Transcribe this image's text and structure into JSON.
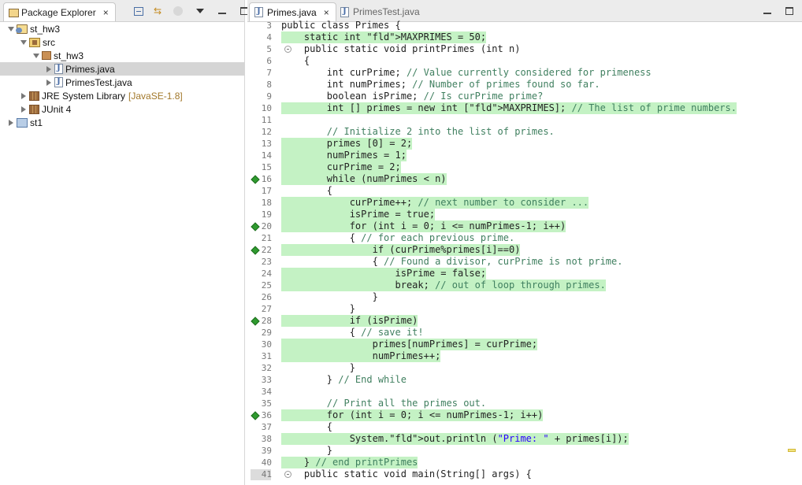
{
  "explorer": {
    "tab_label": "Package Explorer",
    "tab_close": "×",
    "tree": [
      {
        "label": "st_hw3",
        "depth": 0,
        "expanded": true,
        "icon": "java-project-icon"
      },
      {
        "label": "src",
        "depth": 1,
        "expanded": true,
        "icon": "source-folder-icon"
      },
      {
        "label": "st_hw3",
        "depth": 2,
        "expanded": true,
        "icon": "package-icon"
      },
      {
        "label": "Primes.java",
        "depth": 3,
        "expanded": false,
        "icon": "java-file-icon",
        "selected": true
      },
      {
        "label": "PrimesTest.java",
        "depth": 3,
        "expanded": false,
        "icon": "java-file-icon"
      },
      {
        "label": "JRE System Library",
        "tag": "[JavaSE-1.8]",
        "depth": 1,
        "expanded": false,
        "icon": "library-icon"
      },
      {
        "label": "JUnit 4",
        "depth": 1,
        "expanded": false,
        "icon": "library-icon"
      },
      {
        "label": "st1",
        "depth": 0,
        "expanded": false,
        "icon": "project-folder-icon"
      }
    ]
  },
  "editor": {
    "tabs": [
      {
        "label": "Primes.java",
        "active": true,
        "close": "×"
      },
      {
        "label": "PrimesTest.java",
        "active": false
      }
    ],
    "coverage_color": "#c4f2c4",
    "lines": [
      {
        "n": "3",
        "text": "public class Primes {",
        "cov": ""
      },
      {
        "n": "4",
        "text": "    static int MAXPRIMES = 50;",
        "cov": "full"
      },
      {
        "n": "5",
        "text": "    public static void printPrimes (int n)",
        "cov": "",
        "fold": true
      },
      {
        "n": "6",
        "text": "    {",
        "cov": ""
      },
      {
        "n": "7",
        "text": "        int curPrime; // Value currently considered for primeness",
        "cov": ""
      },
      {
        "n": "8",
        "text": "        int numPrimes; // Number of primes found so far.",
        "cov": ""
      },
      {
        "n": "9",
        "text": "        boolean isPrime; // Is curPrime prime?",
        "cov": ""
      },
      {
        "n": "10",
        "text": "        int [] primes = new int [MAXPRIMES]; // The list of prime numbers.",
        "cov": "full"
      },
      {
        "n": "11",
        "text": "",
        "cov": ""
      },
      {
        "n": "12",
        "text": "        // Initialize 2 into the list of primes.",
        "cov": ""
      },
      {
        "n": "13",
        "text": "        primes [0] = 2;",
        "cov": "full"
      },
      {
        "n": "14",
        "text": "        numPrimes = 1;",
        "cov": "full"
      },
      {
        "n": "15",
        "text": "        curPrime = 2;",
        "cov": "full"
      },
      {
        "n": "16",
        "text": "        while (numPrimes < n)",
        "cov": "full",
        "marker": true
      },
      {
        "n": "17",
        "text": "        {",
        "cov": ""
      },
      {
        "n": "18",
        "text": "            curPrime++; // next number to consider ...",
        "cov": "full"
      },
      {
        "n": "19",
        "text": "            isPrime = true;",
        "cov": "full"
      },
      {
        "n": "20",
        "text": "            for (int i = 0; i <= numPrimes-1; i++)",
        "cov": "full",
        "marker": true
      },
      {
        "n": "21",
        "text": "            { // for each previous prime.",
        "cov": ""
      },
      {
        "n": "22",
        "text": "                if (curPrime%primes[i]==0)",
        "cov": "full",
        "marker": true
      },
      {
        "n": "23",
        "text": "                { // Found a divisor, curPrime is not prime.",
        "cov": ""
      },
      {
        "n": "24",
        "text": "                    isPrime = false;",
        "cov": "full"
      },
      {
        "n": "25",
        "text": "                    break; // out of loop through primes.",
        "cov": "full"
      },
      {
        "n": "26",
        "text": "                }",
        "cov": ""
      },
      {
        "n": "27",
        "text": "            }",
        "cov": ""
      },
      {
        "n": "28",
        "text": "            if (isPrime)",
        "cov": "full",
        "marker": true
      },
      {
        "n": "29",
        "text": "            { // save it!",
        "cov": ""
      },
      {
        "n": "30",
        "text": "                primes[numPrimes] = curPrime;",
        "cov": "full"
      },
      {
        "n": "31",
        "text": "                numPrimes++;",
        "cov": "full"
      },
      {
        "n": "32",
        "text": "            }",
        "cov": ""
      },
      {
        "n": "33",
        "text": "        } // End while",
        "cov": ""
      },
      {
        "n": "34",
        "text": "",
        "cov": ""
      },
      {
        "n": "35",
        "text": "        // Print all the primes out.",
        "cov": ""
      },
      {
        "n": "36",
        "text": "        for (int i = 0; i <= numPrimes-1; i++)",
        "cov": "full",
        "marker": true
      },
      {
        "n": "37",
        "text": "        {",
        "cov": ""
      },
      {
        "n": "38",
        "text": "            System.out.println (\"Prime: \" + primes[i]);",
        "cov": "full"
      },
      {
        "n": "39",
        "text": "        }",
        "cov": ""
      },
      {
        "n": "40",
        "text": "    } // end printPrimes",
        "cov": "full"
      },
      {
        "n": "41",
        "text": "    public static void main(String[] args) {",
        "cov": "",
        "fold": true,
        "current": true
      }
    ]
  }
}
